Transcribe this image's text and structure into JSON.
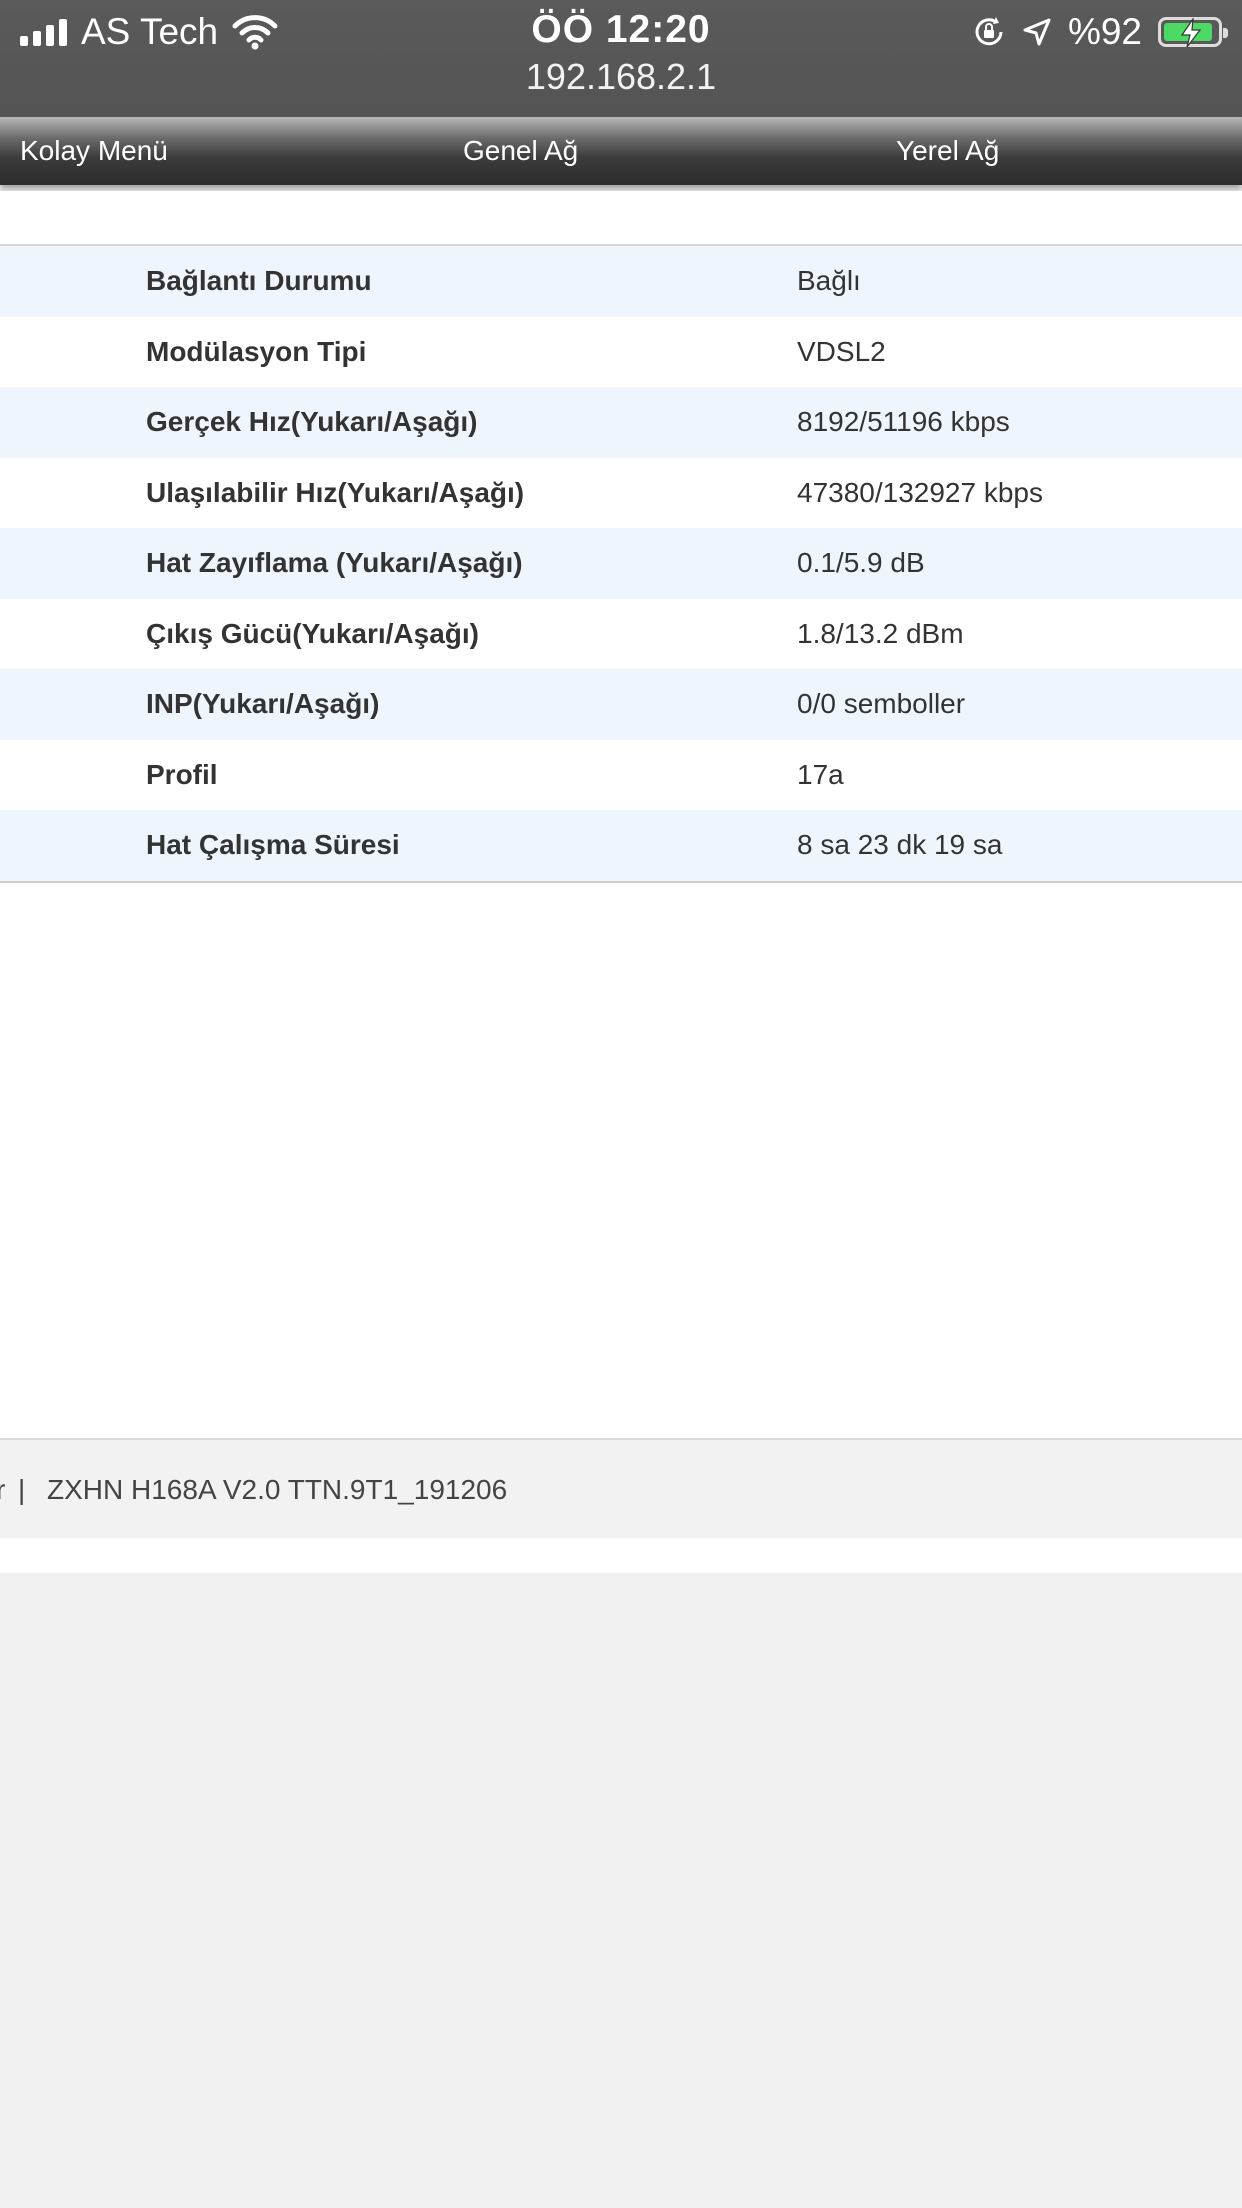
{
  "status_bar": {
    "carrier": "AS Tech",
    "time": "ÖÖ 12:20",
    "battery_percent": "%92",
    "battery_level": 0.92,
    "icons": [
      "signal-icon",
      "wifi-icon",
      "orientation-lock-icon",
      "location-icon",
      "battery-charging-icon"
    ]
  },
  "browser": {
    "url": "192.168.2.1"
  },
  "nav": {
    "items": [
      {
        "label": "Kolay Menü"
      },
      {
        "label": "Genel Ağ"
      },
      {
        "label": "Yerel Ağ"
      }
    ]
  },
  "dsl_status": {
    "rows": [
      {
        "label": "Bağlantı Durumu",
        "value": "Bağlı"
      },
      {
        "label": "Modülasyon Tipi",
        "value": "VDSL2"
      },
      {
        "label": "Gerçek Hız(Yukarı/Aşağı)",
        "value": "8192/51196 kbps"
      },
      {
        "label": "Ulaşılabilir Hız(Yukarı/Aşağı)",
        "value": "47380/132927 kbps"
      },
      {
        "label": "Hat Zayıflama (Yukarı/Aşağı)",
        "value": "0.1/5.9 dB"
      },
      {
        "label": "Çıkış Gücü(Yukarı/Aşağı)",
        "value": "1.8/13.2 dBm"
      },
      {
        "label": "INP(Yukarı/Aşağı)",
        "value": "0/0 semboller"
      },
      {
        "label": "Profil",
        "value": "17a"
      },
      {
        "label": "Hat Çalışma Süresi",
        "value": "8 sa 23 dk 19 sa"
      }
    ]
  },
  "footer": {
    "edge_mark": "r",
    "separator": "|",
    "model": "ZXHN H168A V2.0 TTN.9T1_191206"
  },
  "colors": {
    "status_bar_bg": "#565656",
    "row_alt_bg": "#eef5fc",
    "page_bg": "#f1f1f1",
    "battery_fill": "#4cd964"
  }
}
